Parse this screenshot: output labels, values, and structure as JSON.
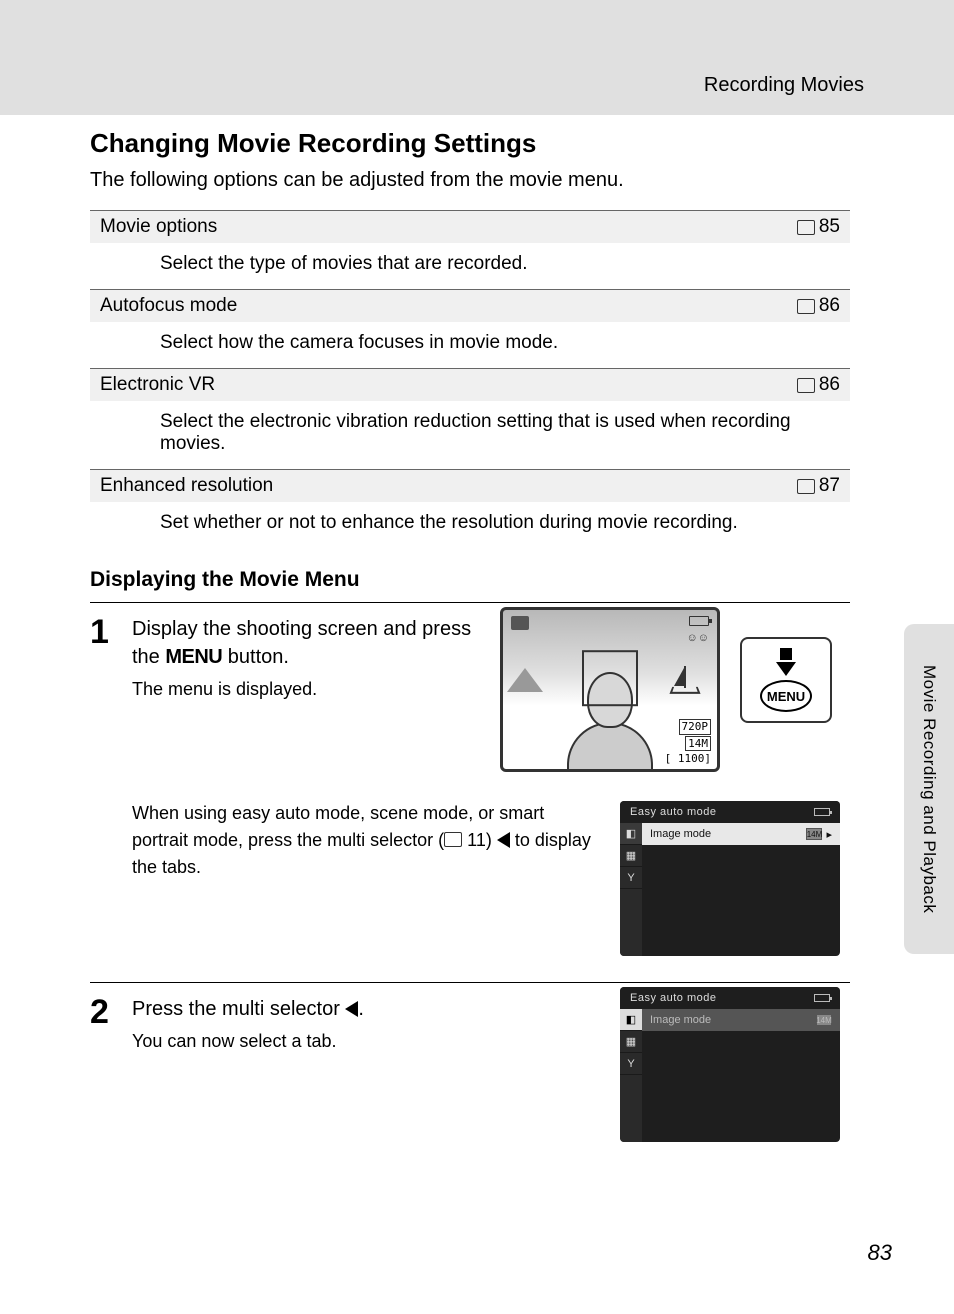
{
  "chapter_header": "Recording Movies",
  "title": "Changing Movie Recording Settings",
  "intro": "The following options can be adjusted from the movie menu.",
  "options": [
    {
      "name": "Movie options",
      "page": "85",
      "desc": "Select the type of movies that are recorded."
    },
    {
      "name": "Autofocus mode",
      "page": "86",
      "desc": "Select how the camera focuses in movie mode."
    },
    {
      "name": "Electronic VR",
      "page": "86",
      "desc": "Select the electronic vibration reduction setting that is used when recording movies."
    },
    {
      "name": "Enhanced resolution",
      "page": "87",
      "desc": "Set whether or not to enhance the resolution during movie recording."
    }
  ],
  "subheading": "Displaying the Movie Menu",
  "step1": {
    "num": "1",
    "title_a": "Display the shooting screen and press the ",
    "title_menu": "MENU",
    "title_b": " button.",
    "sub": "The menu is displayed.",
    "note_a": "When using easy auto mode, scene mode, or smart portrait mode, press the multi selector (",
    "note_ref": "11",
    "note_b": ") ",
    "note_c": " to display the tabs."
  },
  "lcd": {
    "res_line": "720P",
    "size_line": "14M",
    "count": "[ 1100]"
  },
  "menu_button": "MENU",
  "menu_screen": {
    "title": "Easy auto mode",
    "row1": "Image mode",
    "row1_val": "14M",
    "tabs": [
      "📷",
      "🎬",
      "🔧"
    ]
  },
  "step2": {
    "num": "2",
    "title_a": "Press the multi selector ",
    "title_b": ".",
    "sub": "You can now select a tab."
  },
  "side_tab": "Movie Recording and Playback",
  "page_number": "83"
}
